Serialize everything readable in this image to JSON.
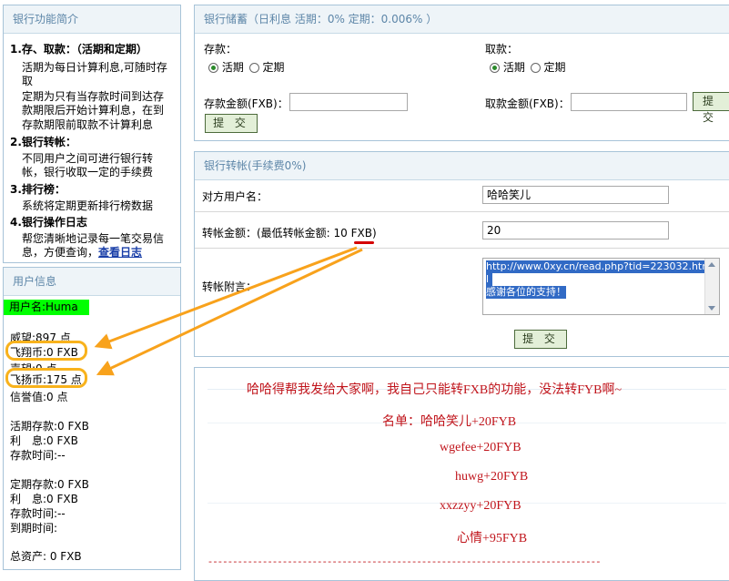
{
  "sidebar": {
    "intro_title": "银行功能简介",
    "sections": [
      {
        "title": "1.存、取款：（活期和定期）",
        "lines": [
          "活期为每日计算利息,可随时存",
          "取",
          "定期为只有当存款时间到达存",
          "款期限后开始计算利息，在到",
          "存款期限前取款不计算利息"
        ]
      },
      {
        "title": "2.银行转帐：",
        "lines": [
          "不同用户之间可进行银行转",
          "帐，银行收取一定的手续费"
        ]
      },
      {
        "title": "3.排行榜：",
        "lines": [
          "系统将定期更新排行榜数据"
        ]
      },
      {
        "title": "4.银行操作日志",
        "lines": [
          "帮您清晰地记录每一笔交易信",
          "息，方便查询，"
        ],
        "link": "查看日志"
      }
    ],
    "user_title": "用户信息",
    "username": "用户名:Huma",
    "prestige": "威望:897 点",
    "fxb": "飞翔币:0 FXB",
    "fyb_partial": "声望:0 点",
    "fyb": "飞扬币:175 点",
    "credit": "信誉值:0 点",
    "current_deposit": "活期存款:0 FXB",
    "current_interest": "利　息:0 FXB",
    "current_time": "存款时间:--",
    "fixed_deposit": "定期存款:0 FXB",
    "fixed_interest": "利　息:0 FXB",
    "fixed_time": "存款时间:--",
    "due_time": "到期时间:",
    "total_assets": "总资产: 0 FXB"
  },
  "savings": {
    "title": "银行储蓄（日利息 活期：0% 定期：0.006% ）",
    "deposit_label": "存款：",
    "withdraw_label": "取款：",
    "opt_current": "活期",
    "opt_fixed": "定期",
    "deposit_amount_label": "存款金额(FXB)：",
    "withdraw_amount_label": "取款金额(FXB)：",
    "submit": "提 交",
    "submit2": "提 交"
  },
  "transfer": {
    "title": "银行转帐(手续费0%)",
    "recipient_label": "对方用户名：",
    "recipient_value": "哈哈笑儿",
    "amount_label": "转帐金额：(最低转帐金额: 10 FXB)",
    "amount_value": "20",
    "note_label": "转帐附言：",
    "note_line1": "http://www.0xy.cn/read.php?tid=223032.htm",
    "note_line2": "l",
    "note_line3": "感谢各位的支持！",
    "submit": "提 交"
  },
  "note": {
    "line1": "哈哈得帮我发给大家啊，我自己只能转FXB的功能，没法转FYB啊~",
    "line2": "名单：哈哈笑儿+20FYB",
    "line3": "wgefee+20FYB",
    "line4": "huwg+20FYB",
    "line5": "xxzzyy+20FYB",
    "line6": "心情+95FYB",
    "dashes": "- - - - - - - - - - - - - - - - - - - - - - - - - - - - - - - - - - - - - - - - - - - - - - - - - - - - - - - - - - - - - - - - - - - - - - - - - - - - - - -"
  },
  "colors": {
    "highlight_green": "#00ff00",
    "annotation_orange": "#f8a21c",
    "note_red": "#c0141b"
  }
}
